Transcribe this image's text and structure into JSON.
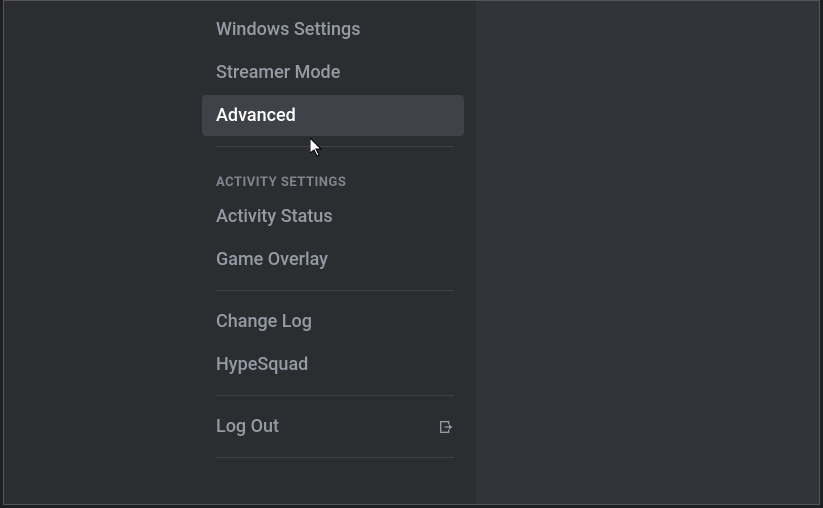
{
  "sidebar": {
    "items": [
      {
        "label": "Windows Settings"
      },
      {
        "label": "Streamer Mode"
      },
      {
        "label": "Advanced"
      }
    ],
    "activityHeader": "ACTIVITY SETTINGS",
    "activityItems": [
      {
        "label": "Activity Status"
      },
      {
        "label": "Game Overlay"
      }
    ],
    "miscItems": [
      {
        "label": "Change Log"
      },
      {
        "label": "HypeSquad"
      }
    ],
    "logout": {
      "label": "Log Out"
    }
  }
}
